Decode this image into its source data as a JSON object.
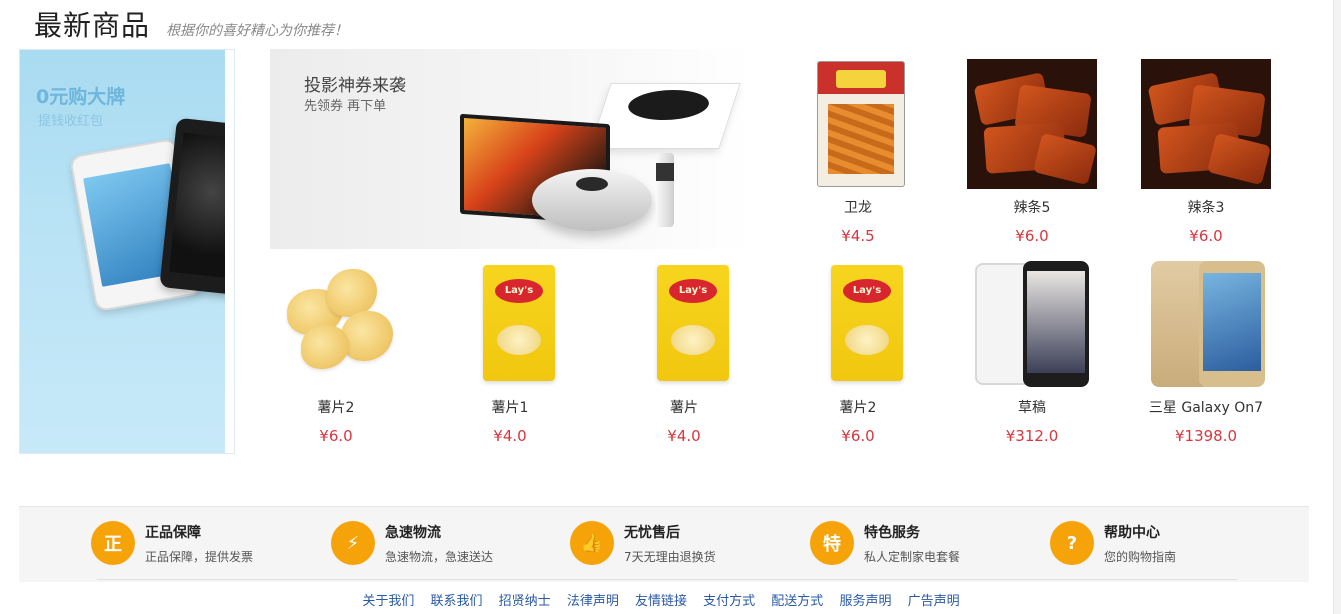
{
  "header": {
    "title": "最新商品",
    "subtitle": "根据你的喜好精心为你推荐！"
  },
  "promo_left": {
    "headline": "0元购大牌",
    "subline": "提钱收红包"
  },
  "banner": {
    "title": "投影神券来袭",
    "subtitle": "先领券 再下单"
  },
  "products": [
    {
      "name": "卫龙",
      "price": "¥4.5",
      "image": "spicy-strip-package"
    },
    {
      "name": "辣条5",
      "price": "¥6.0",
      "image": "spicy-strips"
    },
    {
      "name": "辣条3",
      "price": "¥6.0",
      "image": "spicy-strips"
    },
    {
      "name": "薯片2",
      "price": "¥6.0",
      "image": "potato-chips"
    },
    {
      "name": "薯片1",
      "price": "¥4.0",
      "image": "lays-bag"
    },
    {
      "name": "薯片",
      "price": "¥4.0",
      "image": "lays-bag"
    },
    {
      "name": "薯片2",
      "price": "¥6.0",
      "image": "lays-bag"
    },
    {
      "name": "草稿",
      "price": "¥312.0",
      "image": "lg-phone"
    },
    {
      "name": "三星 Galaxy On7",
      "price": "¥1398.0",
      "image": "samsung-phone"
    }
  ],
  "services": [
    {
      "icon": "shield-icon",
      "glyph": "正",
      "title": "正品保障",
      "desc": "正品保障，提供发票"
    },
    {
      "icon": "express-icon",
      "glyph": "⚡",
      "title": "急速物流",
      "desc": "急速物流，急速送达"
    },
    {
      "icon": "thumbs-up-icon",
      "glyph": "👍",
      "title": "无忧售后",
      "desc": "7天无理由退换货"
    },
    {
      "icon": "special-icon",
      "glyph": "特",
      "title": "特色服务",
      "desc": "私人定制家电套餐"
    },
    {
      "icon": "help-icon",
      "glyph": "?",
      "title": "帮助中心",
      "desc": "您的购物指南"
    }
  ],
  "footer_links": [
    "关于我们",
    "联系我们",
    "招贤纳士",
    "法律声明",
    "友情链接",
    "支付方式",
    "配送方式",
    "服务声明",
    "广告声明"
  ],
  "colors": {
    "price": "#d9363e",
    "service_icon": "#f5a309",
    "link": "#2a5aa6"
  }
}
